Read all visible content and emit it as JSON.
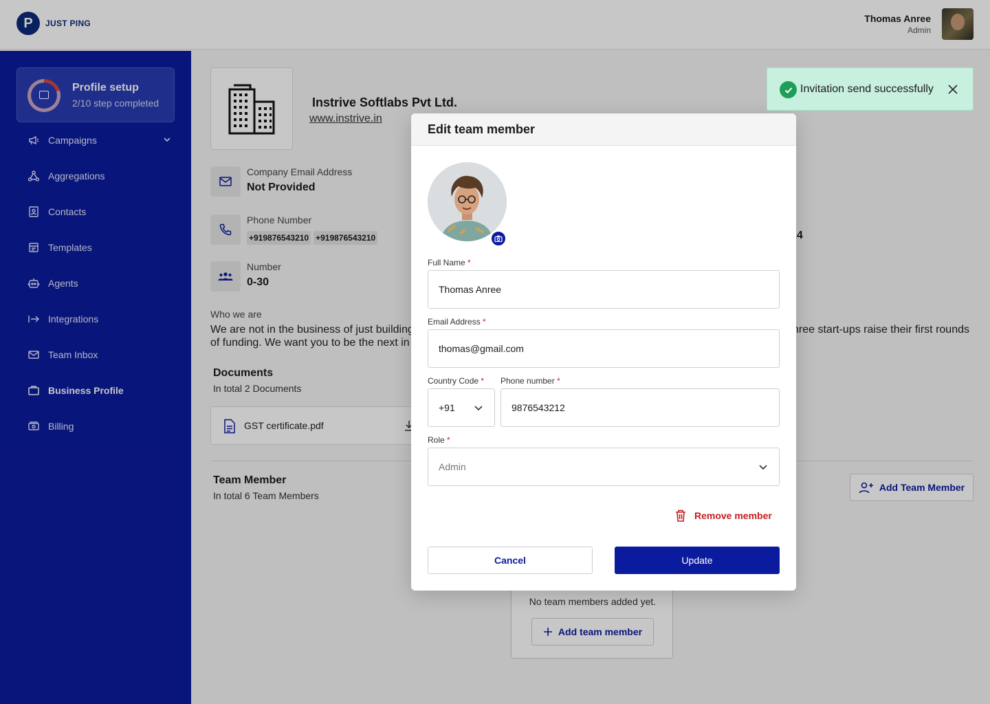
{
  "header": {
    "logo_letter": "P",
    "logo_text": "JUST PING",
    "user_name": "Thomas Anree",
    "user_role": "Admin"
  },
  "sidebar": {
    "profile_setup": {
      "title": "Profile setup",
      "progress_text": "2/10 step completed",
      "progress": 0.2
    },
    "items": [
      {
        "label": "Campaigns",
        "icon": "megaphone-icon",
        "has_chevron": true
      },
      {
        "label": "Aggregations",
        "icon": "network-icon"
      },
      {
        "label": "Contacts",
        "icon": "contacts-icon"
      },
      {
        "label": "Templates",
        "icon": "template-icon"
      },
      {
        "label": "Agents",
        "icon": "robot-icon"
      },
      {
        "label": "Integrations",
        "icon": "arrow-right-bar-icon"
      },
      {
        "label": "Team Inbox",
        "icon": "mail-icon"
      },
      {
        "label": "Business Profile",
        "icon": "briefcase-icon",
        "active": true
      },
      {
        "label": "Billing",
        "icon": "billing-icon"
      }
    ]
  },
  "business": {
    "name": "Instrive Softlabs Pvt Ltd.",
    "website": "www.instrive.in",
    "email_label": "Company Email Address",
    "email_value": "Not Provided",
    "phone_label": "Phone Number",
    "phones": [
      "+919876543210",
      "+919876543210"
    ],
    "number_label": "Number",
    "number_value": "0-30",
    "partial_value": "24",
    "who_label": "Who we are",
    "who_line1_left": "We are not in the business of just building",
    "who_line1_right": "hree start-ups raise their first rounds",
    "who_line2": "of funding. We want you to be the next in"
  },
  "documents": {
    "title": "Documents",
    "subtitle": "In total 2 Documents",
    "items": [
      "GST certificate.pdf"
    ]
  },
  "team": {
    "title": "Team Member",
    "subtitle": "In total 6 Team Members",
    "add_button": "Add Team Member",
    "empty_text": "No team members added yet.",
    "empty_add_button": "Add team member"
  },
  "toast": {
    "message": "Invitation send successfully",
    "accent": "#1e9e5a"
  },
  "modal": {
    "title": "Edit team member",
    "full_name_label": "Full Name",
    "full_name_value": "Thomas Anree",
    "email_label": "Email Address",
    "email_value": "thomas@gmail.com",
    "country_code_label": "Country Code",
    "country_code_value": "+91",
    "phone_label": "Phone number",
    "phone_value": "9876543212",
    "role_label": "Role",
    "role_value": "Admin",
    "required_mark": "*",
    "remove_label": "Remove member",
    "cancel_label": "Cancel",
    "update_label": "Update"
  },
  "colors": {
    "primary": "#0b1b9e",
    "danger": "#c21d1d",
    "success_bg": "#c8f0de"
  }
}
